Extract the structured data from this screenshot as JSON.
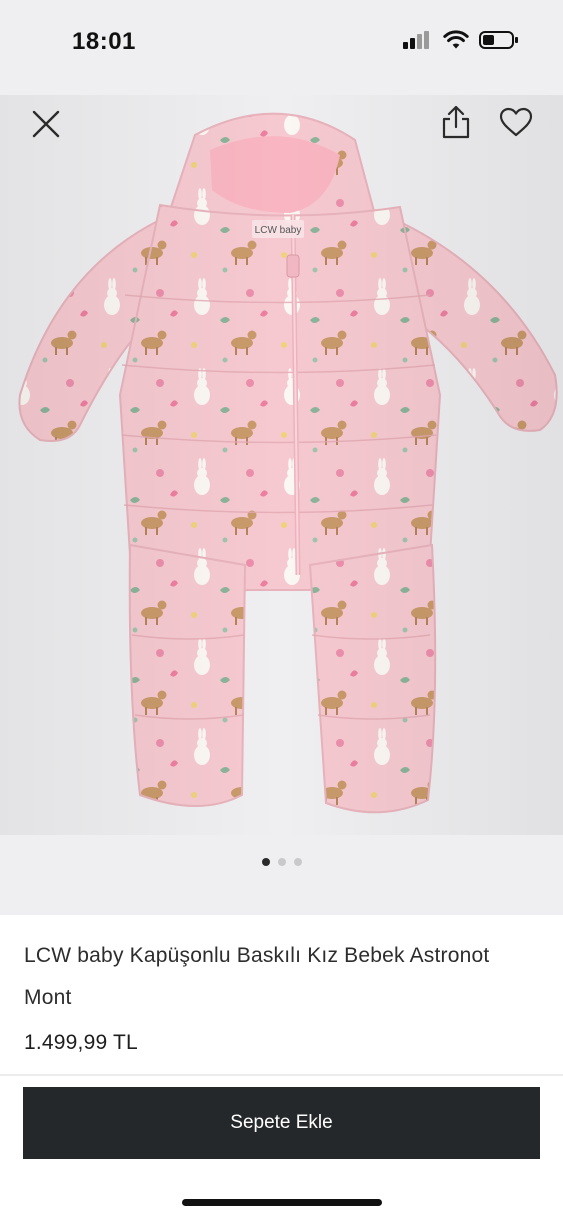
{
  "status_bar": {
    "time": "18:01",
    "icons": [
      "signal-icon",
      "wifi-icon",
      "battery-icon"
    ]
  },
  "top_actions": {
    "close_icon": "close-icon",
    "share_icon": "share-icon",
    "favorite_icon": "heart-icon"
  },
  "gallery": {
    "image_label": "LCW baby",
    "image_count": 3,
    "active_index": 0
  },
  "product": {
    "title": "LCW baby Kapüşonlu Baskılı Kız Bebek Astronot Mont",
    "price": "1.499,99 TL"
  },
  "cta": {
    "add_to_cart_label": "Sepete Ekle"
  },
  "colors": {
    "gallery_bg": "#efeff1",
    "garment_pink": "#f6c8cf",
    "button_bg": "#25282b",
    "button_text": "#ffffff"
  }
}
